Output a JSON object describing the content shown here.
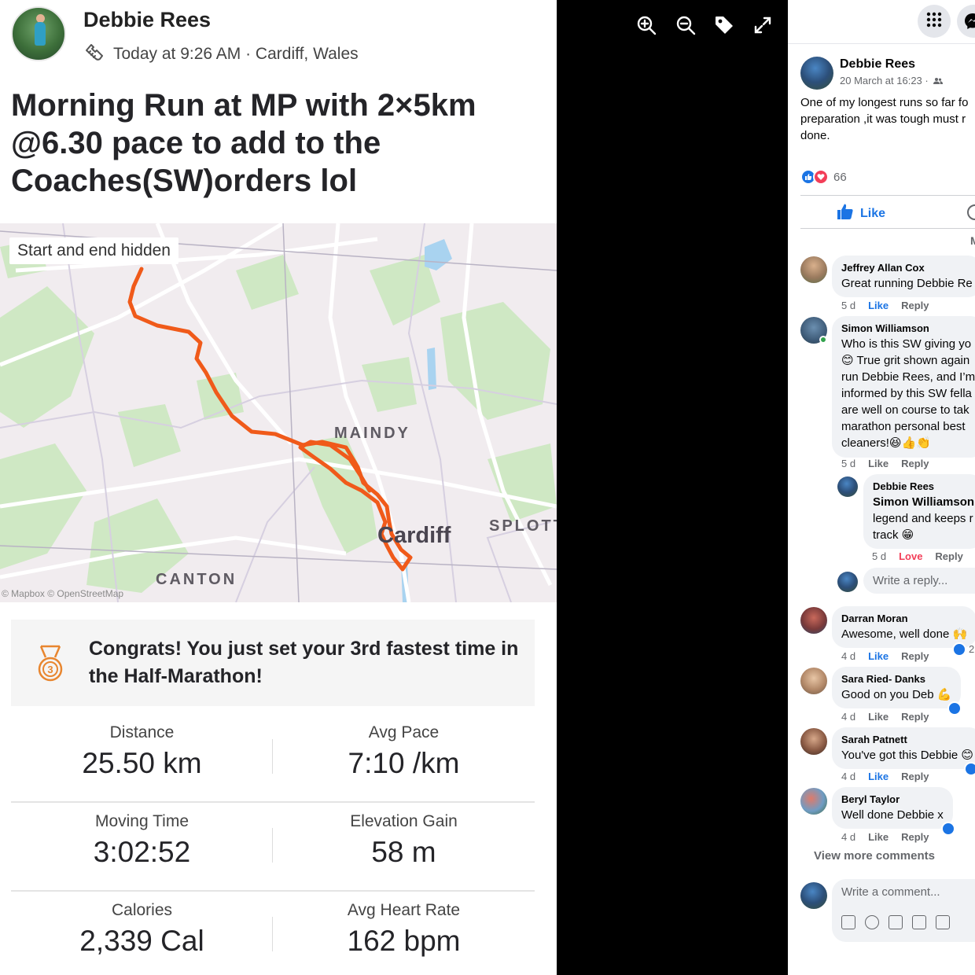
{
  "strava": {
    "athlete_name": "Debbie Rees",
    "activity_meta": "Today at 9:26 AM · Cardiff, Wales",
    "activity_icon": "shoe-icon",
    "title": "Morning Run at MP with  2×5km @6.30 pace to add to the Coaches(SW)orders lol",
    "map": {
      "badge": "Start and end hidden",
      "labels": {
        "maindy": "MAINDY",
        "cardiff": "Cardiff",
        "splott": "SPLOTT",
        "canton": "CANTON"
      },
      "attribution": "© Mapbox © OpenStreetMap",
      "route_color": "#f05a1a"
    },
    "achievement": {
      "icon": "medal-3-icon",
      "text": "Congrats! You just set your 3rd fastest time in the Half-Marathon!"
    },
    "stats": [
      {
        "label": "Distance",
        "value": "25.50 km"
      },
      {
        "label": "Avg Pace",
        "value": "7:10 /km"
      },
      {
        "label": "Moving Time",
        "value": "3:02:52"
      },
      {
        "label": "Elevation Gain",
        "value": "58 m"
      },
      {
        "label": "Calories",
        "value": "2,339 Cal"
      },
      {
        "label": "Avg Heart Rate",
        "value": "162 bpm"
      }
    ]
  },
  "viewer": {
    "tools": [
      "zoom-in-icon",
      "zoom-out-icon",
      "tag-icon",
      "fullscreen-icon"
    ]
  },
  "facebook": {
    "post": {
      "author": "Debbie Rees",
      "date": "20 March at 16:23 ·",
      "text": "One of my longest runs so far for preparation ,it was tough must run done.",
      "text_lines": [
        "One of my longest runs so far fo",
        "preparation ,it was tough must r",
        "done."
      ],
      "reaction_count": "66",
      "like_label": "Like",
      "most_relevant": "M"
    },
    "comments": [
      {
        "name": "Jeffrey Allan Cox",
        "lines": [
          "Great running Debbie Re"
        ],
        "time": "5 d",
        "like": "Like",
        "reply": "Reply"
      },
      {
        "name": "Simon Williamson",
        "lines": [
          "Who is this SW giving yo",
          "😊 True grit shown again",
          "run Debbie Rees, and I’m",
          "informed by this SW fella",
          "are well on course to tak",
          "marathon personal best",
          "cleaners!😆👍👏"
        ],
        "time": "5 d",
        "like": "Like",
        "reply": "Reply"
      },
      {
        "name": "Debbie Rees",
        "lines": [
          "Simon Williamson",
          "legend and keeps r",
          "track 😁"
        ],
        "time": "5 d",
        "like": "Love",
        "reply": "Reply"
      },
      {
        "name": "Darran Moran",
        "lines": [
          "Awesome, well done 🙌"
        ],
        "time": "4 d",
        "like": "Like",
        "reply": "Reply",
        "badge_count": "2"
      },
      {
        "name": "Sara Ried- Danks",
        "lines": [
          "Good on you Deb 💪"
        ],
        "time": "4 d",
        "like": "Like",
        "reply": "Reply"
      },
      {
        "name": "Sarah Patnett",
        "lines": [
          "You've got this Debbie 😊"
        ],
        "time": "4 d",
        "like": "Like",
        "reply": "Reply"
      },
      {
        "name": "Beryl Taylor",
        "lines": [
          "Well done Debbie x"
        ],
        "time": "4 d",
        "like": "Like",
        "reply": "Reply"
      }
    ],
    "write_reply_placeholder": "Write a reply...",
    "view_more": "View more comments",
    "write_comment_placeholder": "Write a comment..."
  }
}
